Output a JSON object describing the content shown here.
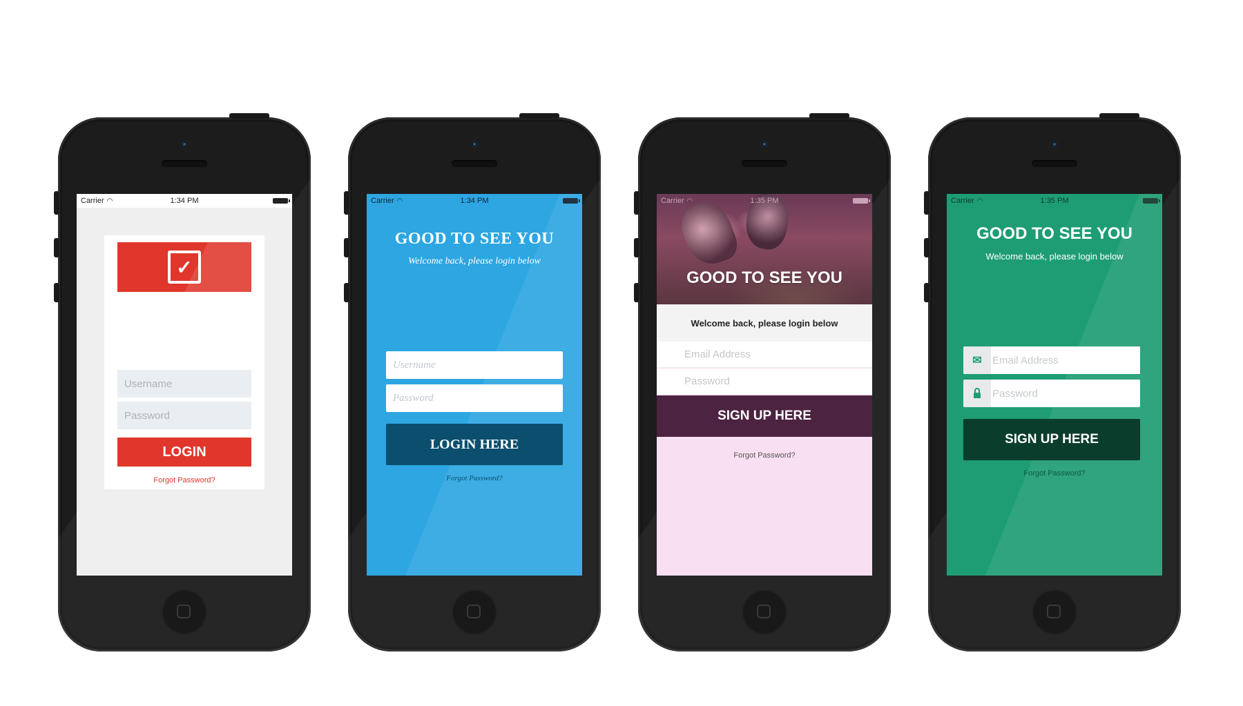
{
  "phones": [
    {
      "status": {
        "carrier": "Carrier",
        "time": "1:34 PM"
      },
      "username_placeholder": "Username",
      "password_placeholder": "Password",
      "login_label": "LOGIN",
      "forgot": "Forgot Password?",
      "accent": "#e0362c"
    },
    {
      "status": {
        "carrier": "Carrier",
        "time": "1:34 PM"
      },
      "title": "GOOD TO SEE YOU",
      "subtitle": "Welcome back, please login below",
      "username_placeholder": "Username",
      "password_placeholder": "Password",
      "login_label": "LOGIN HERE",
      "forgot": "Forgot Password?",
      "accent": "#2da6e2"
    },
    {
      "status": {
        "carrier": "Carrier",
        "time": "1:35 PM"
      },
      "title": "GOOD TO SEE YOU",
      "subtitle": "Welcome back, please login below",
      "email_placeholder": "Email Address",
      "password_placeholder": "Password",
      "signup_label": "SIGN UP HERE",
      "forgot": "Forgot Password?",
      "accent": "#4c2340"
    },
    {
      "status": {
        "carrier": "Carrier",
        "time": "1:35 PM"
      },
      "title": "GOOD TO SEE YOU",
      "subtitle": "Welcome back, please login below",
      "email_placeholder": "Email Address",
      "password_placeholder": "Password",
      "signup_label": "SIGN UP HERE",
      "forgot": "Forgot Password?",
      "accent": "#1e9d74"
    }
  ],
  "icons": {
    "check": "check-icon",
    "email": "envelope-icon",
    "lock": "lock-icon",
    "wifi": "wifi-icon",
    "battery": "battery-icon"
  }
}
